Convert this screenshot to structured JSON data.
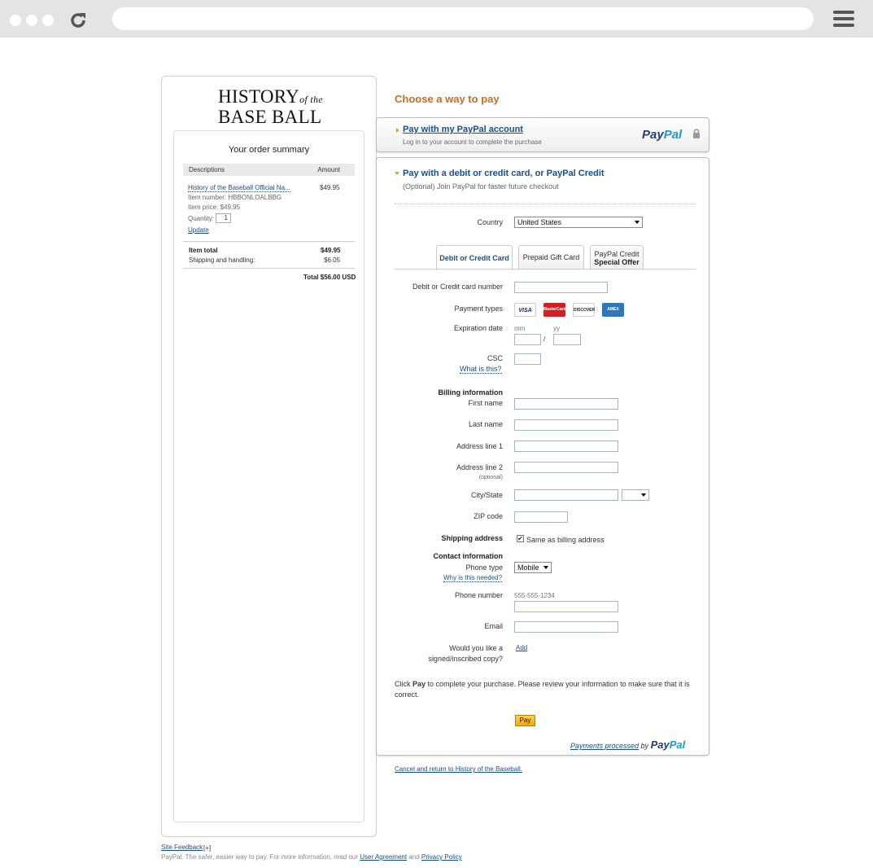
{
  "browser": {
    "url": ""
  },
  "left": {
    "logo": {
      "line1": "HISTORY",
      "ofthe": "of the",
      "line2": "BASE BALL"
    },
    "summary_title": "Your order summary",
    "table_headers": {
      "descriptions": "Descriptions",
      "amount": "Amount"
    },
    "item": {
      "name": "History of the Baseball Official Na...",
      "amount": "$49.95",
      "item_number": "Item number: HBBONLOALBBG",
      "item_price": "Item price: $49.95",
      "quantity_label": "Quantity:",
      "quantity_value": "1",
      "update": "Update"
    },
    "totals": {
      "item_total_label": "Item total",
      "item_total_value": "$49.95",
      "shipping_label": "Shipping and handling:",
      "shipping_value": "$6.05",
      "total": "Total $56.00 USD"
    }
  },
  "right": {
    "choose": "Choose a way to pay",
    "paypal_option": {
      "title": "Pay with my PayPal account",
      "subtitle": "Log in to your account to complete the purchase",
      "logo_pay": "Pay",
      "logo_pal": "Pal"
    },
    "card_option": {
      "title": "Pay with a debit or credit card, or PayPal Credit",
      "subtitle": "(Optional) Join PayPal for faster future checkout"
    },
    "country": {
      "label": "Country",
      "value": "United States"
    },
    "tabs": [
      {
        "label": "Debit or Credit Card"
      },
      {
        "label": "Prepaid Gift Card"
      },
      {
        "label": "PayPal Credit",
        "label2": "Special Offer"
      }
    ],
    "form": {
      "card_number": "Debit or Credit card number",
      "payment_types": "Payment types",
      "cards": [
        "VISA",
        "MasterCard",
        "DISCOVER",
        "AMEX"
      ],
      "expiration": "Expiration date",
      "mm": "mm",
      "yy": "yy",
      "slash": "/",
      "csc": "CSC",
      "what_is_this": "What is this?",
      "billing_info": "Billing information",
      "first_name": "First name",
      "last_name": "Last name",
      "address1": "Address line 1",
      "address2": "Address line 2",
      "optional": "(optional)",
      "city_state": "City/State",
      "zip": "ZIP code",
      "shipping_address": "Shipping address",
      "same_as_billing": "Same as billing address",
      "contact_info": "Contact information",
      "phone_type": "Phone type",
      "phone_type_value": "Mobile",
      "why_needed": "Why is this needed?",
      "phone_number": "Phone number",
      "phone_placeholder": "555-555-1234",
      "email": "Email",
      "signed_line1": "Would you like a",
      "signed_line2": "signed/inscribed copy?",
      "add": "Add"
    },
    "note_pre": "Click ",
    "note_bold": "Pay",
    "note_post": " to complete your purchase. Please review your information to make sure that it is correct.",
    "pay_button": "Pay",
    "processed_by": "Payments processed",
    "by": " by ",
    "processed_pay": "Pay",
    "processed_pal": "Pal",
    "cancel": "Cancel and return to History of the Baseball."
  },
  "footer": {
    "site_feedback": "Site Feedback",
    "bracket": "[+]",
    "text": "PayPal. The safer, easier way to pay. For more information, read our ",
    "user_agreement": "User Agreement",
    "and": " and ",
    "privacy": "Privacy Policy"
  },
  "colors": {
    "accent_orange": "#c86d23",
    "link_blue": "#1a4d8c",
    "paypal_dark": "#253b80",
    "paypal_light": "#179bd7",
    "pay_button": "#f0a800"
  }
}
